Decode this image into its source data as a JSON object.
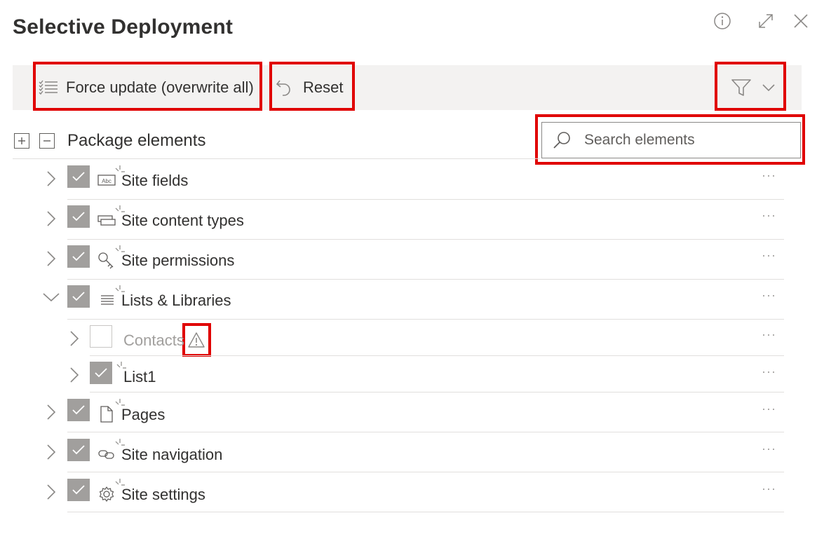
{
  "dialog": {
    "title": "Selective Deployment"
  },
  "toolbar": {
    "force_update_label": "Force update (overwrite all)",
    "reset_label": "Reset"
  },
  "tree": {
    "header_label": "Package elements",
    "search_placeholder": "Search elements",
    "more_glyph": "···",
    "items": [
      {
        "label": "Site fields",
        "checked": true,
        "icon": "text-field-icon",
        "expanded": false
      },
      {
        "label": "Site content types",
        "checked": true,
        "icon": "content-type-icon",
        "expanded": false
      },
      {
        "label": "Site permissions",
        "checked": true,
        "icon": "key-icon",
        "expanded": false
      },
      {
        "label": "Lists & Libraries",
        "checked": true,
        "icon": "list-icon",
        "expanded": true,
        "children": [
          {
            "label": "Contacts",
            "checked": false,
            "warning": true
          },
          {
            "label": "List1",
            "checked": true
          }
        ]
      },
      {
        "label": "Pages",
        "checked": true,
        "icon": "page-icon",
        "expanded": false
      },
      {
        "label": "Site navigation",
        "checked": true,
        "icon": "link-icon",
        "expanded": false
      },
      {
        "label": "Site settings",
        "checked": true,
        "icon": "gear-icon",
        "expanded": false
      }
    ]
  },
  "colors": {
    "highlight": "#e00000",
    "toolbar_bg": "#f3f2f1",
    "checkbox_checked": "#a19f9d"
  }
}
